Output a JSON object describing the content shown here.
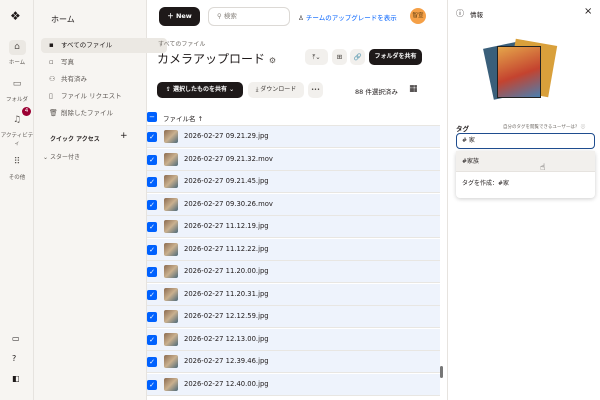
{
  "rail": {
    "items": [
      {
        "label": "ホーム",
        "icon": "home-icon"
      },
      {
        "label": "フォルダ",
        "icon": "folder-icon"
      },
      {
        "label": "アクティビティ",
        "icon": "bell-icon",
        "badge": "4"
      },
      {
        "label": "その他",
        "icon": "grid-icon"
      }
    ]
  },
  "nav": {
    "title": "ホーム",
    "items": [
      {
        "label": "すべてのファイル"
      },
      {
        "label": "写真"
      },
      {
        "label": "共有済み"
      },
      {
        "label": "ファイル リクエスト"
      },
      {
        "label": "削除したファイル"
      }
    ],
    "quick_access": "クイック アクセス",
    "quick_add": "+",
    "starred": "スター付き"
  },
  "header": {
    "new_label": "New",
    "search_placeholder": "検索",
    "upgrade_label": "チームのアップグレードを表示",
    "avatar": "智宣"
  },
  "main": {
    "breadcrumb": "すべてのファイル",
    "title": "カメラアップロード",
    "share_folder": "フォルダを共有",
    "share_selected": "選択したものを共有",
    "download": "ダウンロード",
    "more": "•••",
    "selected_count": "88 件選択済み",
    "col_name": "ファイル名 ↑",
    "files": [
      "2026-02-27 09.21.29.jpg",
      "2026-02-27 09.21.32.mov",
      "2026-02-27 09.21.45.jpg",
      "2026-02-27 09.30.26.mov",
      "2026-02-27 11.12.19.jpg",
      "2026-02-27 11.12.22.jpg",
      "2026-02-27 11.20.00.jpg",
      "2026-02-27 11.20.31.jpg",
      "2026-02-27 12.12.59.jpg",
      "2026-02-27 12.13.00.jpg",
      "2026-02-27 12.39.46.jpg",
      "2026-02-27 12.40.00.jpg"
    ]
  },
  "panel": {
    "title": "情報",
    "tag_label": "タグ",
    "tag_help": "自分のタグを閲覧できるユーザーは？",
    "tag_value": "# 家",
    "suggestion": "#家族",
    "create": "タグを作成：#家"
  },
  "colors": {
    "accent": "#0061fe",
    "dark": "#1e1919",
    "avatar": "#f5a047",
    "badge": "#9b0032"
  }
}
